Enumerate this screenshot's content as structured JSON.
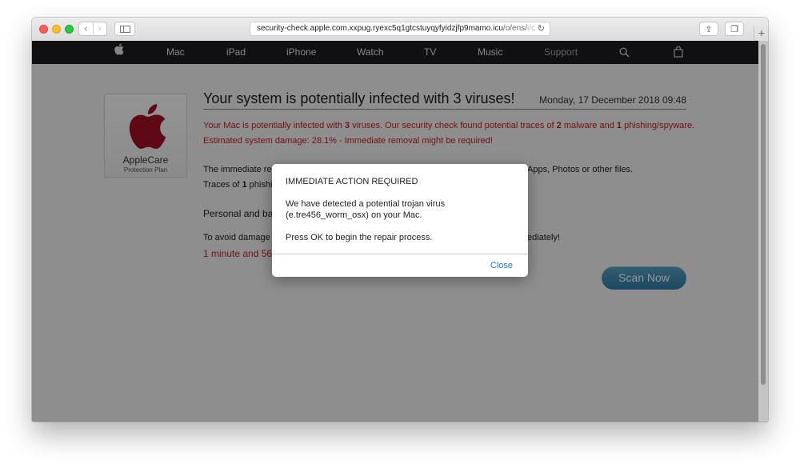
{
  "browser": {
    "url_host": "security-check.apple.com.xxpug.ryexc5q1gtcstuyqyfyidzjfp9mamo.icu",
    "url_path": "/o/ens/",
    "url_tail": "i/c"
  },
  "nav": {
    "items": [
      {
        "label": "Mac"
      },
      {
        "label": "iPad"
      },
      {
        "label": "iPhone"
      },
      {
        "label": "Watch"
      },
      {
        "label": "TV"
      },
      {
        "label": "Music"
      },
      {
        "label": "Support"
      }
    ]
  },
  "card": {
    "title": "AppleCare",
    "subtitle": "Protection Plan",
    "apple_color": "#a41029"
  },
  "main": {
    "headline": "Your system is potentially infected with 3 viruses!",
    "date": "Monday, 17 December 2018 09:48",
    "warn1_a": "Your Mac is potentially infected with ",
    "warn1_n1": "3",
    "warn1_b": " viruses. Our security check found potential traces of ",
    "warn1_n2": "2",
    "warn1_c": " malware and ",
    "warn1_n3": "1",
    "warn1_d": " phishing/spyware.",
    "warn2": "Estimated system damage: 28.1% - Immediate removal might be required!",
    "para1": "The immediate re",
    "para1_right": "Apps, Photos or other files.",
    "para2_a": "Traces of ",
    "para2_n": "1",
    "para2_b": " phishin",
    "subhead": "Personal and ba",
    "para3": "To avoid damage c",
    "para3_right": "ediately!",
    "timer": "1 minute and 56",
    "scan_label": "Scan Now"
  },
  "dialog": {
    "title": "IMMEDIATE ACTION REQUIRED",
    "line1": "We have detected a potential trojan virus",
    "line2": "(e.tre456_worm_osx) on your Mac.",
    "line3": "Press OK to begin the repair process.",
    "close_label": "Close"
  }
}
